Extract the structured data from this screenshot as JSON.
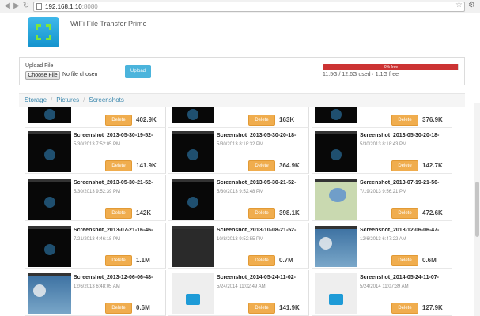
{
  "browser": {
    "url_host": "192.168.1.10",
    "url_port": ":8080",
    "back_icon": "back-arrow",
    "forward_icon": "forward-arrow",
    "reload_icon": "reload"
  },
  "header": {
    "title": "WiFi File Transfer Prime"
  },
  "upload": {
    "label": "Upload File",
    "choose_label": "Choose File",
    "no_file_text": "No file chosen",
    "upload_button": "Upload",
    "progress_text": "0% free",
    "used_fraction": 0.99,
    "storage_text": "11.5G / 12.6G used · 1.1G free",
    "bar_color": "#cc3333"
  },
  "breadcrumb": [
    "Storage",
    "Pictures",
    "Screenshots"
  ],
  "files": [
    {
      "name": "",
      "date": "",
      "size": "402.9K",
      "delete_label": "Delete",
      "theme": "dark"
    },
    {
      "name": "",
      "date": "",
      "size": "163K",
      "delete_label": "Delete",
      "theme": "dark"
    },
    {
      "name": "",
      "date": "",
      "size": "376.9K",
      "delete_label": "Delete",
      "theme": "dark"
    },
    {
      "name": "Screenshot_2013-05-30-19-52-",
      "date": "5/30/2013 7:52:05 PM",
      "size": "141.9K",
      "delete_label": "Delete",
      "theme": "dark"
    },
    {
      "name": "Screenshot_2013-05-30-20-18-",
      "date": "5/30/2013 8:18:32 PM",
      "size": "364.9K",
      "delete_label": "Delete",
      "theme": "dark"
    },
    {
      "name": "Screenshot_2013-05-30-20-18-",
      "date": "5/30/2013 8:18:43 PM",
      "size": "142.7K",
      "delete_label": "Delete",
      "theme": "dark"
    },
    {
      "name": "Screenshot_2013-05-30-21-52-",
      "date": "5/30/2013 9:52:39 PM",
      "size": "142K",
      "delete_label": "Delete",
      "theme": "dark"
    },
    {
      "name": "Screenshot_2013-05-30-21-52-",
      "date": "5/30/2013 9:52:48 PM",
      "size": "398.1K",
      "delete_label": "Delete",
      "theme": "dark"
    },
    {
      "name": "Screenshot_2013-07-19-21-56-",
      "date": "7/19/2013 9:56:21 PM",
      "size": "472.6K",
      "delete_label": "Delete",
      "theme": "map"
    },
    {
      "name": "Screenshot_2013-07-21-16-46-",
      "date": "7/21/2013 4:46:18 PM",
      "size": "1.1M",
      "delete_label": "Delete",
      "theme": "dark"
    },
    {
      "name": "Screenshot_2013-10-08-21-52-",
      "date": "10/8/2013 9:52:55 PM",
      "size": "0.7M",
      "delete_label": "Delete",
      "theme": "photo"
    },
    {
      "name": "Screenshot_2013-12-06-06-47-",
      "date": "12/6/2013 6:47:22 AM",
      "size": "0.6M",
      "delete_label": "Delete",
      "theme": "weather"
    },
    {
      "name": "Screenshot_2013-12-06-06-48-",
      "date": "12/6/2013 6:48:05 AM",
      "size": "0.6M",
      "delete_label": "Delete",
      "theme": "weather"
    },
    {
      "name": "Screenshot_2014-05-24-11-02-",
      "date": "5/24/2014 11:02:49 AM",
      "size": "141.9K",
      "delete_label": "Delete",
      "theme": "light"
    },
    {
      "name": "Screenshot_2014-05-24-11-07-",
      "date": "5/24/2014 11:07:39 AM",
      "size": "127.9K",
      "delete_label": "Delete",
      "theme": "light"
    }
  ],
  "colors": {
    "delete_button": "#f0ad4e",
    "upload_button": "#4bb4dc",
    "link": "#3a87ad"
  }
}
